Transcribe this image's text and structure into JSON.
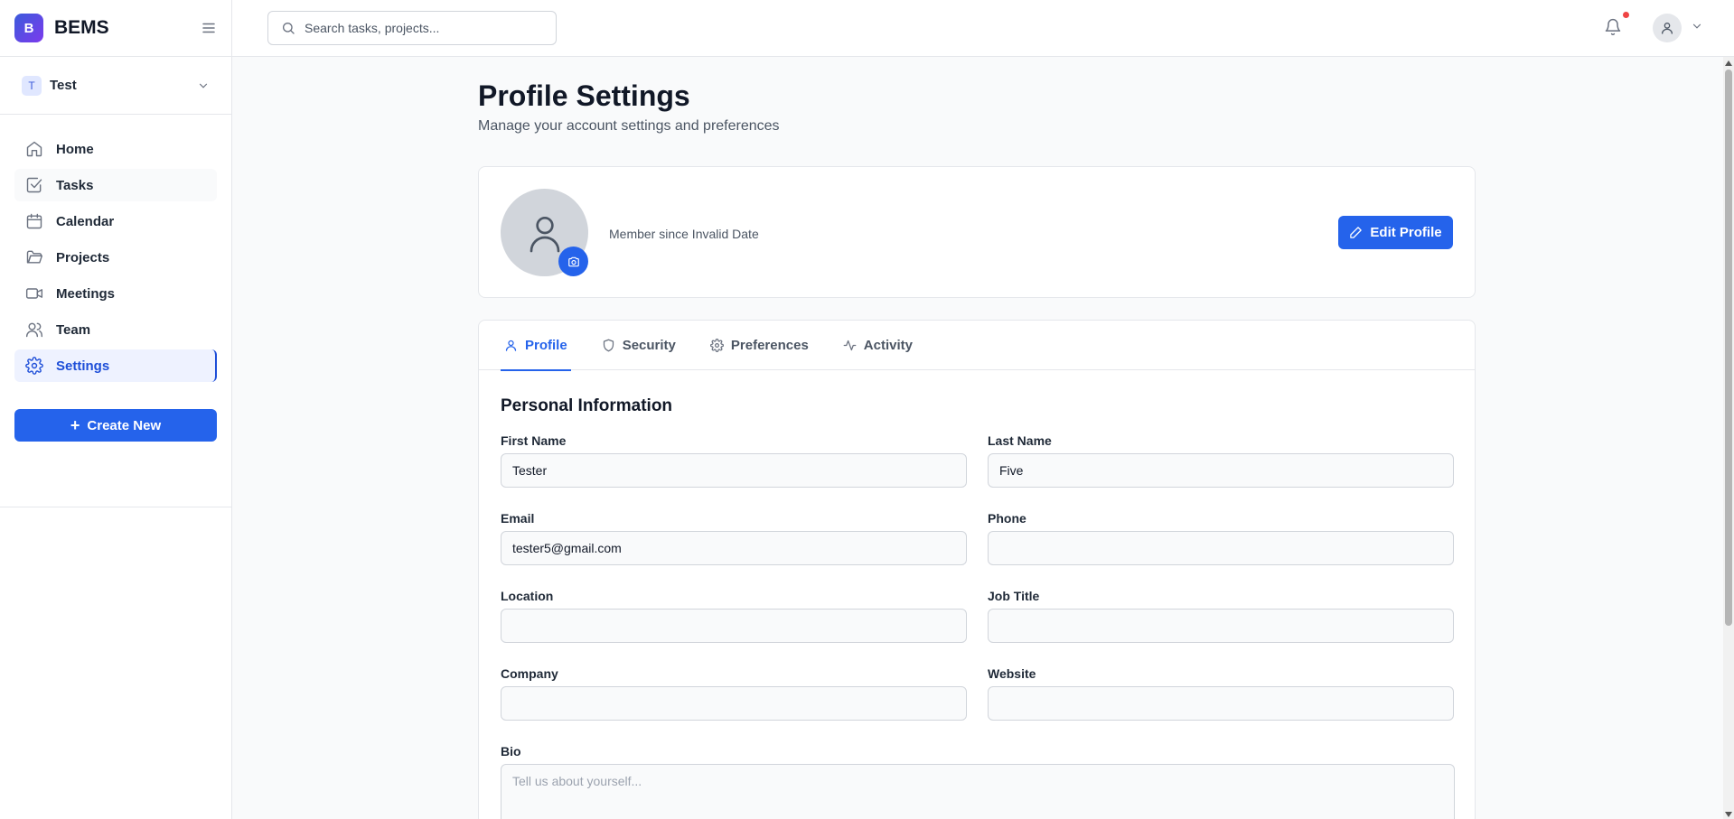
{
  "brand": {
    "logo_letter": "B",
    "name": "BEMS"
  },
  "workspace": {
    "initial": "T",
    "name": "Test"
  },
  "sidebar": {
    "items": [
      {
        "label": "Home",
        "icon": "home-icon"
      },
      {
        "label": "Tasks",
        "icon": "check-square-icon"
      },
      {
        "label": "Calendar",
        "icon": "calendar-icon"
      },
      {
        "label": "Projects",
        "icon": "folder-icon"
      },
      {
        "label": "Meetings",
        "icon": "video-icon"
      },
      {
        "label": "Team",
        "icon": "users-icon"
      },
      {
        "label": "Settings",
        "icon": "gear-icon",
        "active": true
      }
    ],
    "create_label": "Create New"
  },
  "header": {
    "search_placeholder": "Search tasks, projects...",
    "has_notification": true
  },
  "page": {
    "title": "Profile Settings",
    "subtitle": "Manage your account settings and preferences"
  },
  "profile": {
    "member_since": "Member since Invalid Date",
    "edit_label": "Edit Profile"
  },
  "tabs": [
    {
      "label": "Profile",
      "icon": "user-icon",
      "active": true
    },
    {
      "label": "Security",
      "icon": "shield-icon"
    },
    {
      "label": "Preferences",
      "icon": "gear-icon"
    },
    {
      "label": "Activity",
      "icon": "activity-icon"
    }
  ],
  "form": {
    "section_title": "Personal Information",
    "first_name": {
      "label": "First Name",
      "value": "Tester"
    },
    "last_name": {
      "label": "Last Name",
      "value": "Five"
    },
    "email": {
      "label": "Email",
      "value": "tester5@gmail.com"
    },
    "phone": {
      "label": "Phone",
      "value": ""
    },
    "location": {
      "label": "Location",
      "value": ""
    },
    "job_title": {
      "label": "Job Title",
      "value": ""
    },
    "company": {
      "label": "Company",
      "value": ""
    },
    "website": {
      "label": "Website",
      "value": ""
    },
    "bio": {
      "label": "Bio",
      "value": "",
      "placeholder": "Tell us about yourself..."
    }
  },
  "colors": {
    "accent": "#2563eb",
    "active_nav_bg": "#eef2ff",
    "notification_dot": "#ef4444"
  }
}
